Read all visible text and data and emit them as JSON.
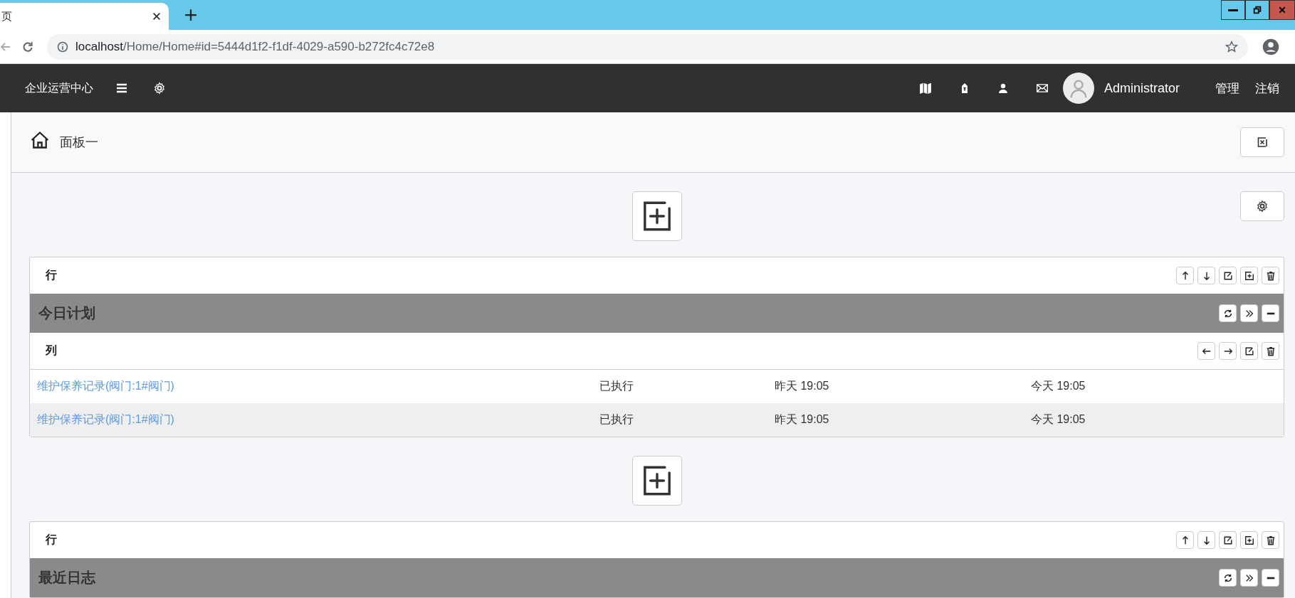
{
  "browser": {
    "tab_title": "页",
    "url_host": "localhost",
    "url_path": "/Home/Home#id=5444d1f2-f1df-4029-a590-b272fc4c72e8"
  },
  "navbar": {
    "brand": "企业运营中心",
    "user_name": "Administrator",
    "links": [
      "管理",
      "注销"
    ]
  },
  "breadcrumb": {
    "title": "面板一"
  },
  "panels": [
    {
      "row_label": "行",
      "title": "今日计划",
      "column_label": "列",
      "rows": [
        {
          "name": "维护保养记录(阀门:1#阀门)",
          "status": "已执行",
          "column_3": "昨天 19:05",
          "column_4": "今天 19:05"
        },
        {
          "name": "维护保养记录(阀门:1#阀门)",
          "status": "已执行",
          "column_3": "昨天 19:05",
          "column_4": "今天 19:05"
        }
      ]
    },
    {
      "row_label": "行",
      "title": "最近日志"
    }
  ]
}
